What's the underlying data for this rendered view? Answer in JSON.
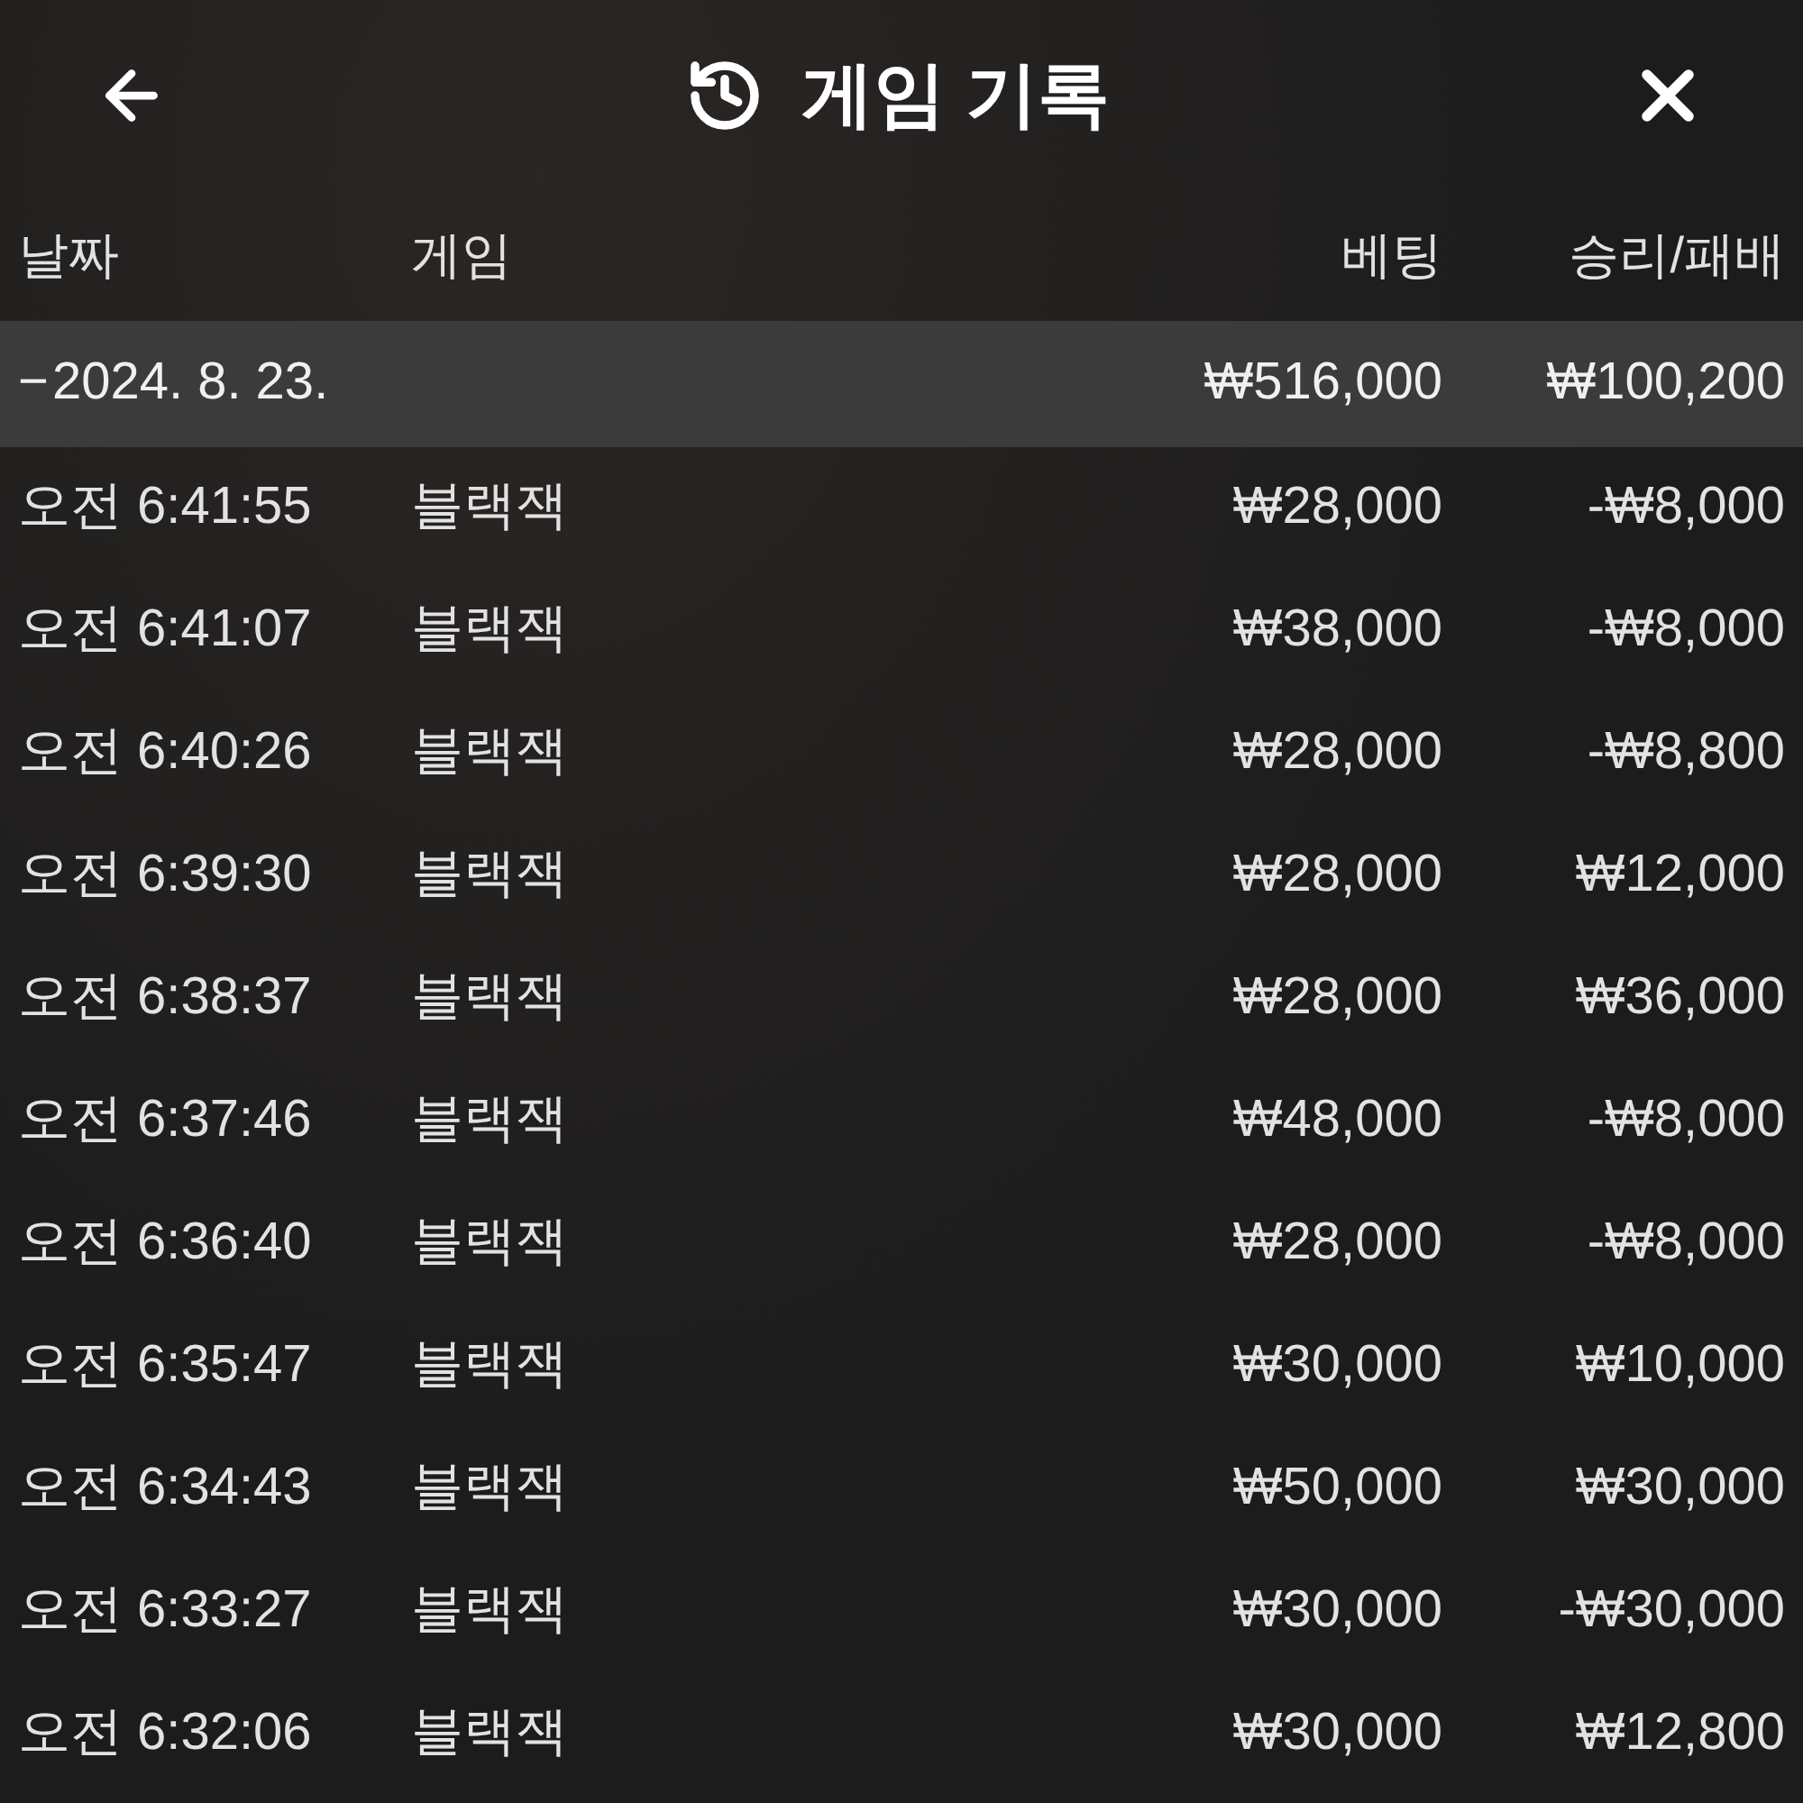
{
  "header": {
    "title": "게임 기록"
  },
  "columns": [
    "날짜",
    "게임",
    "베팅",
    "승리/패배"
  ],
  "group": {
    "toggle": "−",
    "expanded": true,
    "date": "2024. 8. 23.",
    "bet": "₩516,000",
    "result": "₩100,200"
  },
  "rows": [
    {
      "time": "오전 6:41:55",
      "game": "블랙잭",
      "bet": "₩28,000",
      "result": "-₩8,000"
    },
    {
      "time": "오전 6:41:07",
      "game": "블랙잭",
      "bet": "₩38,000",
      "result": "-₩8,000"
    },
    {
      "time": "오전 6:40:26",
      "game": "블랙잭",
      "bet": "₩28,000",
      "result": "-₩8,800"
    },
    {
      "time": "오전 6:39:30",
      "game": "블랙잭",
      "bet": "₩28,000",
      "result": "₩12,000"
    },
    {
      "time": "오전 6:38:37",
      "game": "블랙잭",
      "bet": "₩28,000",
      "result": "₩36,000"
    },
    {
      "time": "오전 6:37:46",
      "game": "블랙잭",
      "bet": "₩48,000",
      "result": "-₩8,000"
    },
    {
      "time": "오전 6:36:40",
      "game": "블랙잭",
      "bet": "₩28,000",
      "result": "-₩8,000"
    },
    {
      "time": "오전 6:35:47",
      "game": "블랙잭",
      "bet": "₩30,000",
      "result": "₩10,000"
    },
    {
      "time": "오전 6:34:43",
      "game": "블랙잭",
      "bet": "₩50,000",
      "result": "₩30,000"
    },
    {
      "time": "오전 6:33:27",
      "game": "블랙잭",
      "bet": "₩30,000",
      "result": "-₩30,000"
    },
    {
      "time": "오전 6:32:06",
      "game": "블랙잭",
      "bet": "₩30,000",
      "result": "₩12,800"
    }
  ]
}
